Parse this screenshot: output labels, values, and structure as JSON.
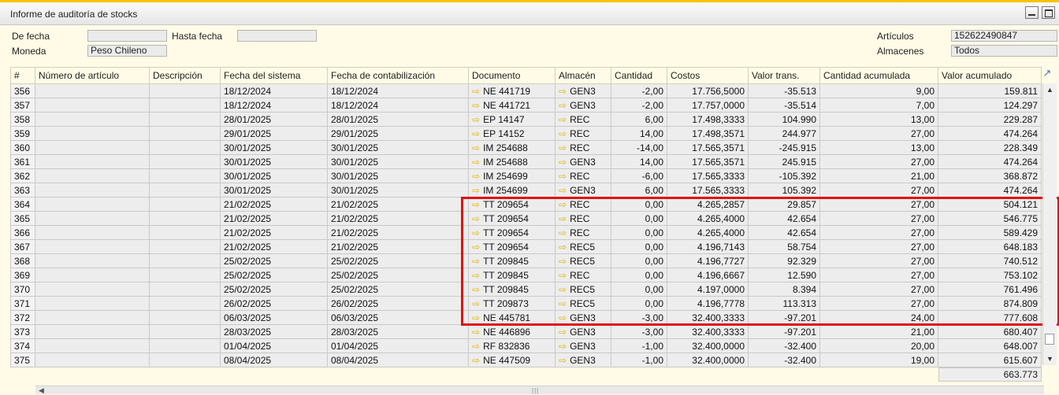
{
  "window": {
    "title": "Informe de auditoría de stocks"
  },
  "filters": {
    "de_fecha_label": "De fecha",
    "de_fecha_value": "",
    "hasta_fecha_label": "Hasta fecha",
    "hasta_fecha_value": "",
    "moneda_label": "Moneda",
    "moneda_value": "Peso Chileno",
    "articulos_label": "Artículos",
    "articulos_value": "152622490847",
    "almacenes_label": "Almacenes",
    "almacenes_value": "Todos"
  },
  "table": {
    "columns": [
      "#",
      "Número de artículo",
      "Descripción",
      "Fecha del sistema",
      "Fecha de contabilización",
      "Documento",
      "Almacén",
      "Cantidad",
      "Costos",
      "Valor trans.",
      "Cantidad acumulada",
      "Valor acumulado"
    ],
    "rows": [
      [
        "356",
        "",
        "",
        "18/12/2024",
        "18/12/2024",
        "NE 441719",
        "GEN3",
        "-2,00",
        "17.756,5000",
        "-35.513",
        "9,00",
        "159.811"
      ],
      [
        "357",
        "",
        "",
        "18/12/2024",
        "18/12/2024",
        "NE 441721",
        "GEN3",
        "-2,00",
        "17.757,0000",
        "-35.514",
        "7,00",
        "124.297"
      ],
      [
        "358",
        "",
        "",
        "28/01/2025",
        "28/01/2025",
        "EP 14147",
        "REC",
        "6,00",
        "17.498,3333",
        "104.990",
        "13,00",
        "229.287"
      ],
      [
        "359",
        "",
        "",
        "29/01/2025",
        "29/01/2025",
        "EP 14152",
        "REC",
        "14,00",
        "17.498,3571",
        "244.977",
        "27,00",
        "474.264"
      ],
      [
        "360",
        "",
        "",
        "30/01/2025",
        "30/01/2025",
        "IM 254688",
        "REC",
        "-14,00",
        "17.565,3571",
        "-245.915",
        "13,00",
        "228.349"
      ],
      [
        "361",
        "",
        "",
        "30/01/2025",
        "30/01/2025",
        "IM 254688",
        "GEN3",
        "14,00",
        "17.565,3571",
        "245.915",
        "27,00",
        "474.264"
      ],
      [
        "362",
        "",
        "",
        "30/01/2025",
        "30/01/2025",
        "IM 254699",
        "REC",
        "-6,00",
        "17.565,3333",
        "-105.392",
        "21,00",
        "368.872"
      ],
      [
        "363",
        "",
        "",
        "30/01/2025",
        "30/01/2025",
        "IM 254699",
        "GEN3",
        "6,00",
        "17.565,3333",
        "105.392",
        "27,00",
        "474.264"
      ],
      [
        "364",
        "",
        "",
        "21/02/2025",
        "21/02/2025",
        "TT 209654",
        "REC",
        "0,00",
        "4.265,2857",
        "29.857",
        "27,00",
        "504.121"
      ],
      [
        "365",
        "",
        "",
        "21/02/2025",
        "21/02/2025",
        "TT 209654",
        "REC",
        "0,00",
        "4.265,4000",
        "42.654",
        "27,00",
        "546.775"
      ],
      [
        "366",
        "",
        "",
        "21/02/2025",
        "21/02/2025",
        "TT 209654",
        "REC",
        "0,00",
        "4.265,4000",
        "42.654",
        "27,00",
        "589.429"
      ],
      [
        "367",
        "",
        "",
        "21/02/2025",
        "21/02/2025",
        "TT 209654",
        "REC5",
        "0,00",
        "4.196,7143",
        "58.754",
        "27,00",
        "648.183"
      ],
      [
        "368",
        "",
        "",
        "25/02/2025",
        "25/02/2025",
        "TT 209845",
        "REC5",
        "0,00",
        "4.196,7727",
        "92.329",
        "27,00",
        "740.512"
      ],
      [
        "369",
        "",
        "",
        "25/02/2025",
        "25/02/2025",
        "TT 209845",
        "REC",
        "0,00",
        "4.196,6667",
        "12.590",
        "27,00",
        "753.102"
      ],
      [
        "370",
        "",
        "",
        "25/02/2025",
        "25/02/2025",
        "TT 209845",
        "REC5",
        "0,00",
        "4.197,0000",
        "8.394",
        "27,00",
        "761.496"
      ],
      [
        "371",
        "",
        "",
        "26/02/2025",
        "26/02/2025",
        "TT 209873",
        "REC5",
        "0,00",
        "4.196,7778",
        "113.313",
        "27,00",
        "874.809"
      ],
      [
        "372",
        "",
        "",
        "06/03/2025",
        "06/03/2025",
        "NE 445781",
        "GEN3",
        "-3,00",
        "32.400,3333",
        "-97.201",
        "24,00",
        "777.608"
      ],
      [
        "373",
        "",
        "",
        "28/03/2025",
        "28/03/2025",
        "NE 446896",
        "GEN3",
        "-3,00",
        "32.400,3333",
        "-97.201",
        "21,00",
        "680.407"
      ],
      [
        "374",
        "",
        "",
        "01/04/2025",
        "01/04/2025",
        "RF 832836",
        "GEN3",
        "-1,00",
        "32.400,0000",
        "-32.400",
        "20,00",
        "648.007"
      ],
      [
        "375",
        "",
        "",
        "08/04/2025",
        "08/04/2025",
        "NE 447509",
        "GEN3",
        "-1,00",
        "32.400,0000",
        "-32.400",
        "19,00",
        "615.607"
      ]
    ],
    "total_valor_acumulado": "663.773"
  },
  "colors": {
    "highlight_border": "#e01010",
    "link_arrow": "#e8b300",
    "accent": "#f5c400"
  },
  "icons": {
    "link_arrow": "arrow-right-icon",
    "expand": "expand-icon"
  }
}
